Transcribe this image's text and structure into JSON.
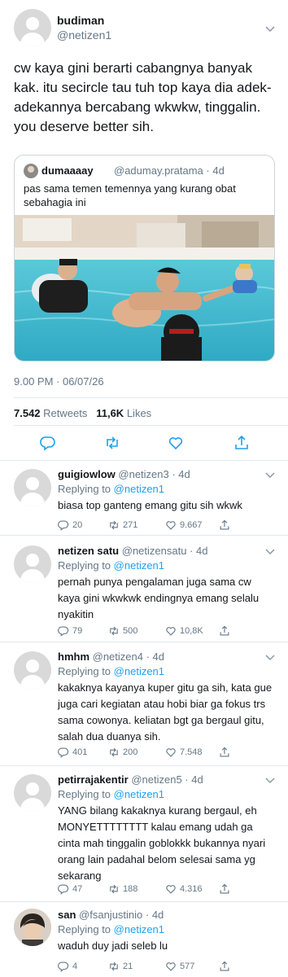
{
  "main_tweet": {
    "name": "budiman",
    "handle": "@netizen1",
    "text": "cw kaya gini berarti cabangnya banyak kak. itu secircle tau tuh top kaya dia adek-adekannya bercabang wkwkw, tinggalin. you deserve better sih.",
    "quote": {
      "name": "dumaaaay",
      "handle_time": "@adumay.pratama · 4d",
      "text": "pas sama temen temennya yang kurang obat sebahagia ini"
    },
    "timestamp": "9.00 PM · 06/07/26",
    "retweets_count": "7.542",
    "retweets_label": "Retweets",
    "likes_count": "11,6K",
    "likes_label": "Likes"
  },
  "replies": [
    {
      "name": "guigiowlow",
      "handle_time": "@netizen3 · 4d",
      "replying_prefix": "Replying to",
      "replying_to": "@netizen1",
      "text": "biasa top ganteng emang gitu sih wkwk",
      "reply_count": "20",
      "retweet_count": "271",
      "like_count": "9.667"
    },
    {
      "name": "netizen satu",
      "handle_time": "@netizensatu · 4d",
      "replying_prefix": "Replying to",
      "replying_to": "@netizen1",
      "text": "pernah punya pengalaman juga sama cw kaya gini wkwkwk endingnya emang selalu nyakitin",
      "reply_count": "79",
      "retweet_count": "500",
      "like_count": "10,8K"
    },
    {
      "name": "hmhm",
      "handle_time": "@netizen4 · 4d",
      "replying_prefix": "Replying to",
      "replying_to": "@netizen1",
      "text": "kakaknya kayanya kuper gitu ga sih, kata gue juga cari kegiatan atau hobi biar ga fokus trs sama cowonya. keliatan bgt ga bergaul gitu, salah dua duanya sih.",
      "reply_count": "401",
      "retweet_count": "200",
      "like_count": "7.548"
    },
    {
      "name": "petirrajakentir",
      "handle_time": "@netizen5 · 4d",
      "replying_prefix": "Replying to",
      "replying_to": "@netizen1",
      "text": "YANG bilang kakaknya kurang bergaul, eh MONYETTTTTTTT kalau emang udah ga cinta mah tinggalin goblokkk bukannya nyari orang lain padahal belom selesai sama yg sekarang",
      "reply_count": "47",
      "retweet_count": "188",
      "like_count": "4.316"
    },
    {
      "name": "san",
      "handle_time": "@fsanjustinio · 4d",
      "replying_prefix": "Replying to",
      "replying_to": "@netizen1",
      "text": "waduh duy jadi seleb lu",
      "reply_count": "4",
      "retweet_count": "21",
      "like_count": "577"
    }
  ],
  "colors": {
    "text": "#14171a",
    "secondary": "#657786",
    "link": "#1da1f2",
    "border": "#e1e8ed",
    "avatar_placeholder": "#d9d9d9"
  },
  "icons": [
    "reply-icon",
    "retweet-icon",
    "like-icon",
    "share-icon",
    "chevron-down-icon"
  ]
}
